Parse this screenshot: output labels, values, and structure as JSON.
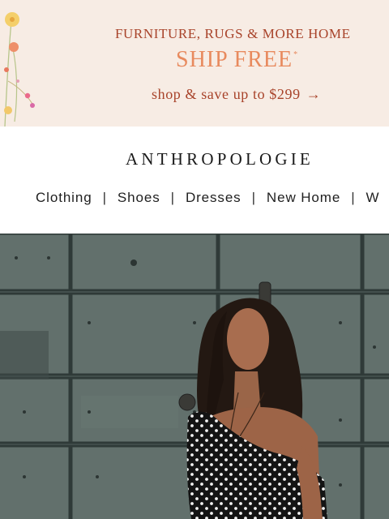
{
  "promo": {
    "line1": "FURNITURE, RUGS & MORE HOME",
    "line2": "SHIP FREE",
    "asterisk": "*",
    "line3": "shop & save up to $299",
    "arrow": "→"
  },
  "brand": {
    "name": "ANTHROPOLOGIE"
  },
  "nav": {
    "items": [
      "Clothing",
      "Shoes",
      "Dresses",
      "New Home",
      "W"
    ],
    "separator": "|"
  },
  "hero": {
    "image_subject": "woman in black polka-dot one-shoulder top in front of a weathered teal wooden door"
  },
  "colors": {
    "promo_bg": "#f7ece4",
    "promo_text_dark": "#a8432a",
    "promo_text_accent": "#e88a5e",
    "brand_text": "#1a1a1a",
    "door_teal": "#56645f"
  }
}
